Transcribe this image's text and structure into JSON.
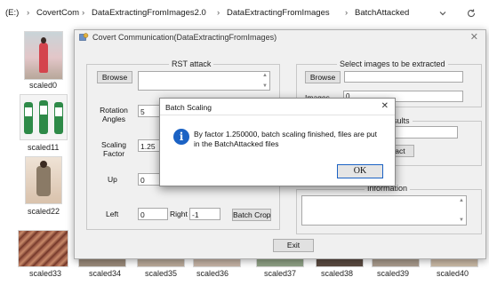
{
  "explorer": {
    "breadcrumb": [
      "(E:)",
      "CovertCom",
      "DataExtractingFromImages2.0",
      "DataExtractingFromImages",
      "BatchAttacked"
    ],
    "separator": "›",
    "icons": {
      "dropdown": "chevron-down-icon",
      "refresh": "refresh-icon"
    }
  },
  "thumbnails": {
    "left_column": [
      "scaled0",
      "scaled11",
      "scaled22",
      "scaled33"
    ],
    "bottom_row": [
      "scaled34",
      "scaled35",
      "scaled36",
      "scaled37",
      "scaled38",
      "scaled39",
      "scaled40"
    ]
  },
  "main_window": {
    "title": "Covert Communication(DataExtractingFromImages)",
    "close_glyph": "✕",
    "rst_attack": {
      "label": "RST attack",
      "browse_label": "Browse",
      "rotation_label": "Rotation Angles",
      "rotation_value": "5",
      "scaling_label": "Scaling Factor",
      "scaling_value": "1.25",
      "up_label": "Up",
      "up_value": "0",
      "left_label": "Left",
      "left_value": "0",
      "right_label": "Right",
      "right_value": "-1",
      "batch_crop_label": "Batch Crop"
    },
    "select_images": {
      "label": "Select images to be extracted",
      "browse_label": "Browse",
      "images_label": "Images",
      "images_value": "0"
    },
    "results": {
      "label_partial": "sults",
      "button_partial": "ract"
    },
    "information": {
      "label": "Information"
    },
    "exit_label": "Exit"
  },
  "dialog": {
    "title": "Batch Scaling",
    "close_glyph": "✕",
    "message": "By factor 1.250000, batch scaling finished, files are put in the BatchAttacked files",
    "ok_label": "OK",
    "icon": "info-icon",
    "icon_glyph": "i"
  }
}
